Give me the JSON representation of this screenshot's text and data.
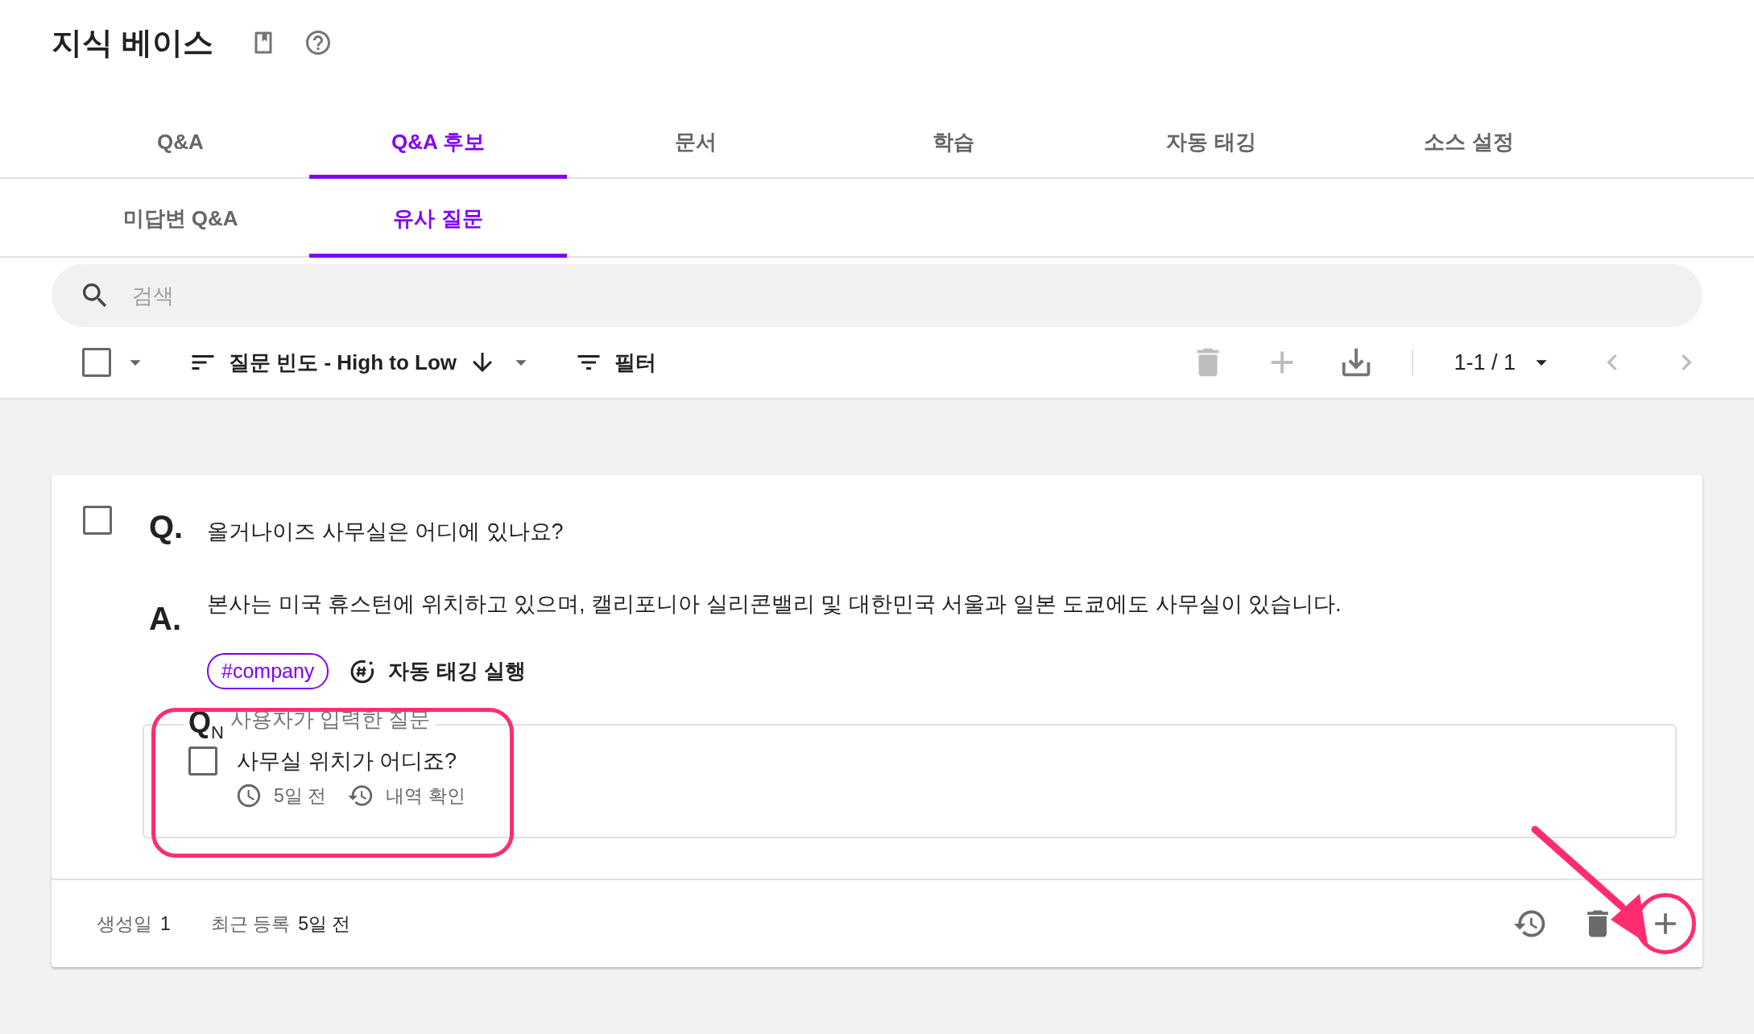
{
  "header": {
    "title": "지식 베이스"
  },
  "tabs": [
    {
      "label": "Q&A",
      "selected": false
    },
    {
      "label": "Q&A 후보",
      "selected": true
    },
    {
      "label": "문서",
      "selected": false
    },
    {
      "label": "학습",
      "selected": false
    },
    {
      "label": "자동 태깅",
      "selected": false
    },
    {
      "label": "소스 설정",
      "selected": false
    }
  ],
  "subtabs": [
    {
      "label": "미답변 Q&A",
      "selected": false
    },
    {
      "label": "유사 질문",
      "selected": true
    }
  ],
  "search": {
    "placeholder": "검색"
  },
  "toolbar": {
    "select_all": {
      "checked": false
    },
    "sort": {
      "label": "질문 빈도 - High to Low"
    },
    "filter": {
      "label": "필터"
    },
    "actions": [
      {
        "kind": "delete",
        "disabled": true
      },
      {
        "kind": "add",
        "disabled": true
      },
      {
        "kind": "download",
        "disabled": false
      }
    ],
    "pagination": {
      "range": "1-1 / 1",
      "prev": {
        "disabled": true
      },
      "next": {
        "disabled": true
      }
    }
  },
  "card": {
    "checked": false,
    "question_mark": "Q.",
    "question": "올거나이즈 사무실은 어디에 있나요?",
    "answer_mark": "A.",
    "answer": "본사는 미국 휴스턴에 위치하고 있으며, 캘리포니아 실리콘밸리 및 대한민국 서울과 일본 도쿄에도 사무실이 있습니다.",
    "tags": [
      "#company"
    ],
    "auto_tag": "자동 태깅 실행",
    "user_questions": {
      "label": "Q$_{N}$",
      "caption": "사용자가 입력한 질문",
      "items": [
        {
          "text": "사무실 위치가 어디죠?",
          "checked": false,
          "time": "5일 전",
          "history": "내역 확인"
        }
      ]
    },
    "footer": {
      "created_label": "생성일",
      "created_value": "1",
      "recent_label": "최근 등록",
      "recent_value": "5일 전",
      "actions": [
        {
          "kind": "history"
        },
        {
          "kind": "delete"
        },
        {
          "kind": "add"
        }
      ]
    }
  },
  "annotations": [
    {
      "kind": "frame"
    },
    {
      "kind": "arrow"
    },
    {
      "kind": "circle"
    }
  ]
}
